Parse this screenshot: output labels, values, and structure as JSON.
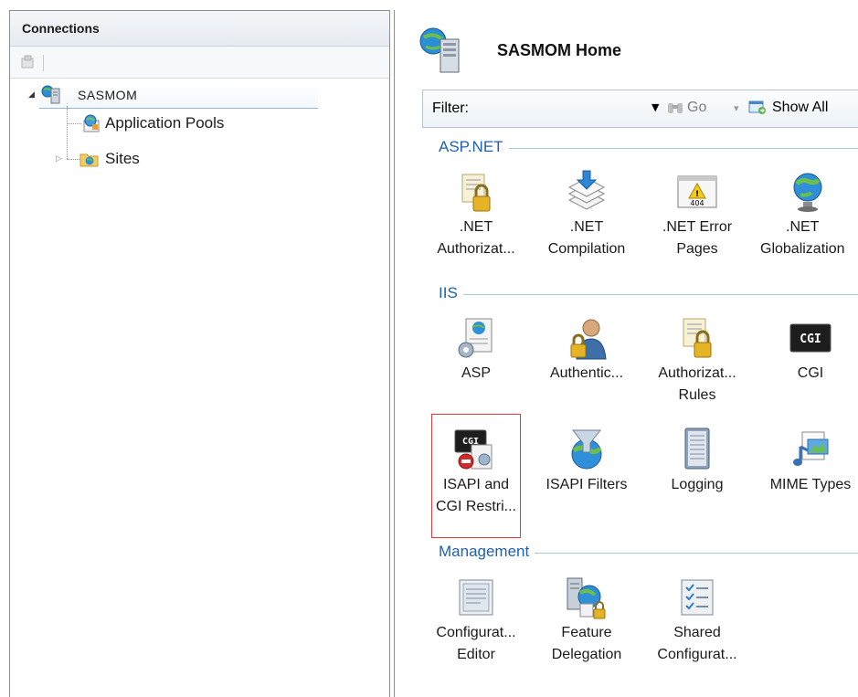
{
  "connections": {
    "title": "Connections",
    "tree": {
      "root": "SASMOM",
      "children": [
        "Application Pools",
        "Sites"
      ]
    }
  },
  "home": {
    "title": "SASMOM Home",
    "filter": {
      "label": "Filter:",
      "go_label": "Go",
      "show_all_label": "Show All"
    },
    "groups": [
      {
        "name": "ASP.NET",
        "features": [
          {
            "line1": ".NET",
            "line2": "Authorizat...",
            "icon": "net-authorization-icon"
          },
          {
            "line1": ".NET",
            "line2": "Compilation",
            "icon": "net-compilation-icon"
          },
          {
            "line1": ".NET Error",
            "line2": "Pages",
            "icon": "net-error-pages-icon"
          },
          {
            "line1": ".NET",
            "line2": "Globalization",
            "icon": "net-globalization-icon"
          }
        ]
      },
      {
        "name": "IIS",
        "features": [
          {
            "line1": "ASP",
            "line2": "",
            "icon": "asp-icon"
          },
          {
            "line1": "Authentic...",
            "line2": "",
            "icon": "authentication-icon"
          },
          {
            "line1": "Authorizat...",
            "line2": "Rules",
            "icon": "authorization-rules-icon"
          },
          {
            "line1": "CGI",
            "line2": "",
            "icon": "cgi-icon",
            "icon_text": "CGI"
          },
          {
            "line1": "ISAPI and",
            "line2": "CGI Restri...",
            "icon": "isapi-cgi-restrictions-icon",
            "icon_text": "CGI",
            "selected": true
          },
          {
            "line1": "ISAPI Filters",
            "line2": "",
            "icon": "isapi-filters-icon"
          },
          {
            "line1": "Logging",
            "line2": "",
            "icon": "logging-icon"
          },
          {
            "line1": "MIME Types",
            "line2": "",
            "icon": "mime-types-icon"
          }
        ]
      },
      {
        "name": "Management",
        "features": [
          {
            "line1": "Configurat...",
            "line2": "Editor",
            "icon": "configuration-editor-icon"
          },
          {
            "line1": "Feature",
            "line2": "Delegation",
            "icon": "feature-delegation-icon"
          },
          {
            "line1": "Shared",
            "line2": "Configurat...",
            "icon": "shared-configuration-icon"
          }
        ]
      }
    ]
  },
  "colors": {
    "group_label": "#1f5fb4",
    "selection_border": "#e23b3b"
  }
}
